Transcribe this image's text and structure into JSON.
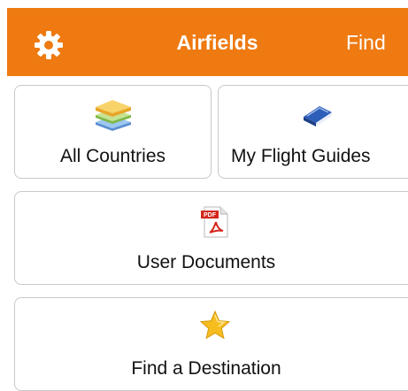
{
  "navbar": {
    "title": "Airfields",
    "find_label": "Find",
    "settings_icon": "gear-icon",
    "background": "#ee7a11"
  },
  "tiles": {
    "all_countries": {
      "label": "All Countries",
      "icon": "stacked-books-icon"
    },
    "my_flight_guides": {
      "label": "My Flight Guides",
      "icon": "blue-book-icon"
    },
    "user_documents": {
      "label": "User Documents",
      "icon": "pdf-document-icon"
    },
    "find_destination": {
      "label": "Find a Destination",
      "icon": "star-icon"
    }
  }
}
